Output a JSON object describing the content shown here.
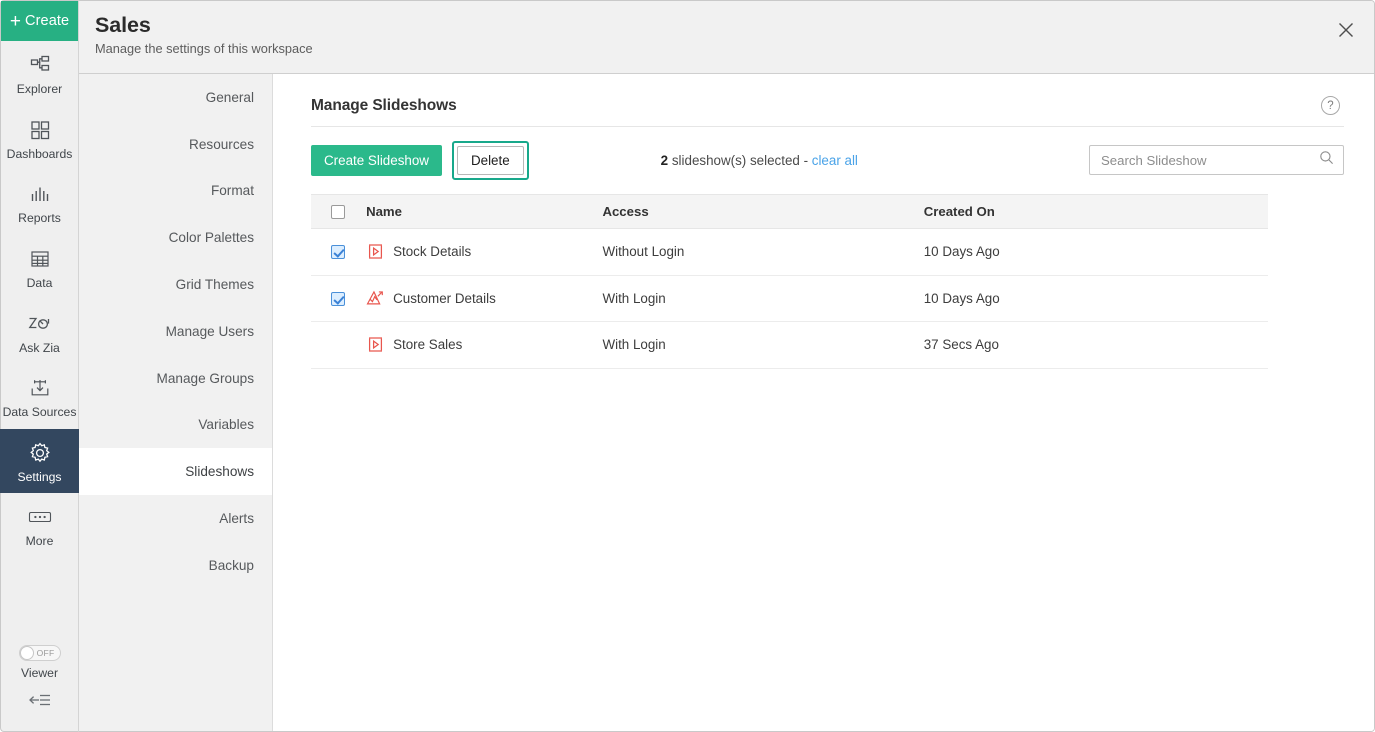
{
  "rail": {
    "create_label": "Create",
    "items": [
      {
        "label": "Explorer",
        "icon": "explorer-icon",
        "active": false
      },
      {
        "label": "Dashboards",
        "icon": "dashboards-icon",
        "active": false
      },
      {
        "label": "Reports",
        "icon": "reports-icon",
        "active": false
      },
      {
        "label": "Data",
        "icon": "data-icon",
        "active": false
      },
      {
        "label": "Ask Zia",
        "icon": "ask-zia-icon",
        "active": false
      },
      {
        "label": "Data Sources",
        "icon": "data-sources-icon",
        "active": false
      },
      {
        "label": "Settings",
        "icon": "gear-icon",
        "active": true
      },
      {
        "label": "More",
        "icon": "more-icon",
        "active": false
      }
    ],
    "viewer": {
      "label": "Viewer",
      "toggle_state": "OFF"
    },
    "collapse_icon": "collapse-left-icon"
  },
  "header": {
    "title": "Sales",
    "subtitle": "Manage the settings of this workspace",
    "close_icon": "close-icon"
  },
  "settings_menu": {
    "items": [
      {
        "label": "General",
        "active": false
      },
      {
        "label": "Resources",
        "active": false
      },
      {
        "label": "Format",
        "active": false
      },
      {
        "label": "Color Palettes",
        "active": false
      },
      {
        "label": "Grid Themes",
        "active": false
      },
      {
        "label": "Manage Users",
        "active": false
      },
      {
        "label": "Manage Groups",
        "active": false
      },
      {
        "label": "Variables",
        "active": false
      },
      {
        "label": "Slideshows",
        "active": true
      },
      {
        "label": "Alerts",
        "active": false
      },
      {
        "label": "Backup",
        "active": false
      }
    ]
  },
  "content": {
    "title": "Manage Slideshows",
    "help_icon": "help-icon",
    "help_glyph": "?",
    "toolbar": {
      "create_label": "Create Slideshow",
      "delete_label": "Delete",
      "selection_count": "2",
      "selection_text": " slideshow(s) selected - ",
      "clear_all_label": "clear all"
    },
    "search": {
      "placeholder": "Search Slideshow",
      "value": "",
      "icon": "search-icon"
    },
    "table": {
      "columns": [
        "Name",
        "Access",
        "Created On"
      ],
      "header_checkbox_checked": false,
      "rows": [
        {
          "checked": true,
          "icon": "slideshow-play-icon",
          "name": "Stock Details",
          "access": "Without Login",
          "created_on": "10 Days Ago"
        },
        {
          "checked": true,
          "icon": "chart-peak-icon",
          "name": "Customer Details",
          "access": "With Login",
          "created_on": "10 Days Ago"
        },
        {
          "checked": false,
          "icon": "slideshow-play-icon",
          "name": "Store Sales",
          "access": "With Login",
          "created_on": "37 Secs Ago"
        }
      ]
    }
  },
  "colors": {
    "brand_green": "#27b083",
    "primary_button": "#2bb98b",
    "focus_ring": "#18a88b",
    "active_rail": "#33475f",
    "link_blue": "#4aa3e8",
    "icon_red": "#e8564e",
    "checkbox_blue": "#4a90d9"
  }
}
